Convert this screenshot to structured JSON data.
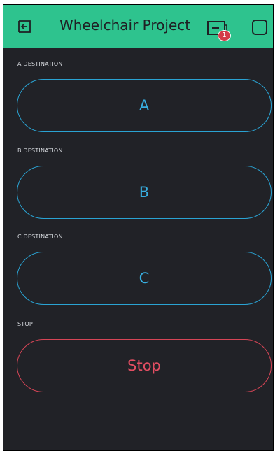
{
  "app_bar": {
    "title": "Wheelchair Project",
    "back_icon": "exit-arrow-icon",
    "device_icon": "device-icon",
    "device_badge": "1",
    "menu_icon": "square-icon",
    "background_color": "#2ec38e"
  },
  "widgets": [
    {
      "label": "A DESTINATION",
      "button_text": "A",
      "color": "#2aa3d3"
    },
    {
      "label": "B DESTINATION",
      "button_text": "B",
      "color": "#2aa3d3"
    },
    {
      "label": "C DESTINATION",
      "button_text": "C",
      "color": "#2aa3d3"
    },
    {
      "label": "STOP",
      "button_text": "Stop",
      "color": "#d64556"
    }
  ]
}
